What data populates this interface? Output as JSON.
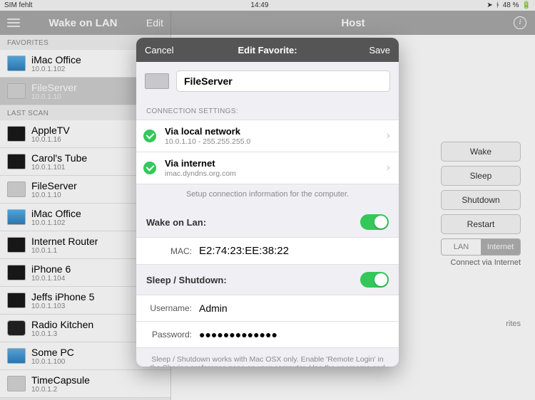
{
  "status": {
    "carrier": "SIM fehlt",
    "time": "14:49",
    "battery": "48 %"
  },
  "nav": {
    "left_title": "Wake on LAN",
    "edit": "Edit",
    "right_title": "Host"
  },
  "sidebar": {
    "favorites_header": "FAVORITES",
    "lastscan_header": "LAST SCAN",
    "favorites": [
      {
        "name": "iMac Office",
        "ip": "10.0.1.102",
        "kind": "monitor"
      },
      {
        "name": "FileServer",
        "ip": "10.0.1.10",
        "kind": "server",
        "selected": true
      }
    ],
    "lastscan": [
      {
        "name": "AppleTV",
        "ip": "10.0.1.16",
        "kind": "dark"
      },
      {
        "name": "Carol's Tube",
        "ip": "10.0.1.101",
        "kind": "dark"
      },
      {
        "name": "FileServer",
        "ip": "10.0.1.10",
        "kind": "server"
      },
      {
        "name": "iMac Office",
        "ip": "10.0.1.102",
        "kind": "monitor"
      },
      {
        "name": "Internet Router",
        "ip": "10.0.1.1",
        "kind": "dark"
      },
      {
        "name": "iPhone 6",
        "ip": "10.0.1.104",
        "kind": "dark"
      },
      {
        "name": "Jeffs iPhone 5",
        "ip": "10.0.1.103",
        "kind": "dark"
      },
      {
        "name": "Radio Kitchen",
        "ip": "10.0.1.3",
        "kind": "radio"
      },
      {
        "name": "Some PC",
        "ip": "10.0.1.100",
        "kind": "monitor"
      },
      {
        "name": "TimeCapsule",
        "ip": "10.0.1.2",
        "kind": "server"
      }
    ]
  },
  "host": {
    "buttons": {
      "wake": "Wake",
      "sleep": "Sleep",
      "shutdown": "Shutdown",
      "restart": "Restart"
    },
    "seg_lan": "LAN",
    "seg_internet": "Internet",
    "connect_via": "Connect via Internet",
    "fav_hint_suffix": "rites"
  },
  "modal": {
    "cancel": "Cancel",
    "title": "Edit Favorite:",
    "save": "Save",
    "name_value": "FileServer",
    "conn_header": "CONNECTION SETTINGS:",
    "local": {
      "title": "Via local network",
      "sub": "10.0.1.10 - 255.255.255.0"
    },
    "internet": {
      "title": "Via internet",
      "sub": "imac.dyndns.org.com"
    },
    "conn_hint": "Setup connection information for the computer.",
    "wol_label": "Wake on Lan:",
    "mac_label": "MAC:",
    "mac_value": "E2:74:23:EE:38:22",
    "sleep_label": "Sleep / Shutdown:",
    "user_label": "Username:",
    "user_value": "Admin",
    "pass_label": "Password:",
    "pass_value": "●●●●●●●●●●●●●",
    "foot_hint": "Sleep / Shutdown works with Mac OSX  only. Enable 'Remote Login' in the Sharing preference pane on your computer. Use the username and password you use on your Mac."
  }
}
